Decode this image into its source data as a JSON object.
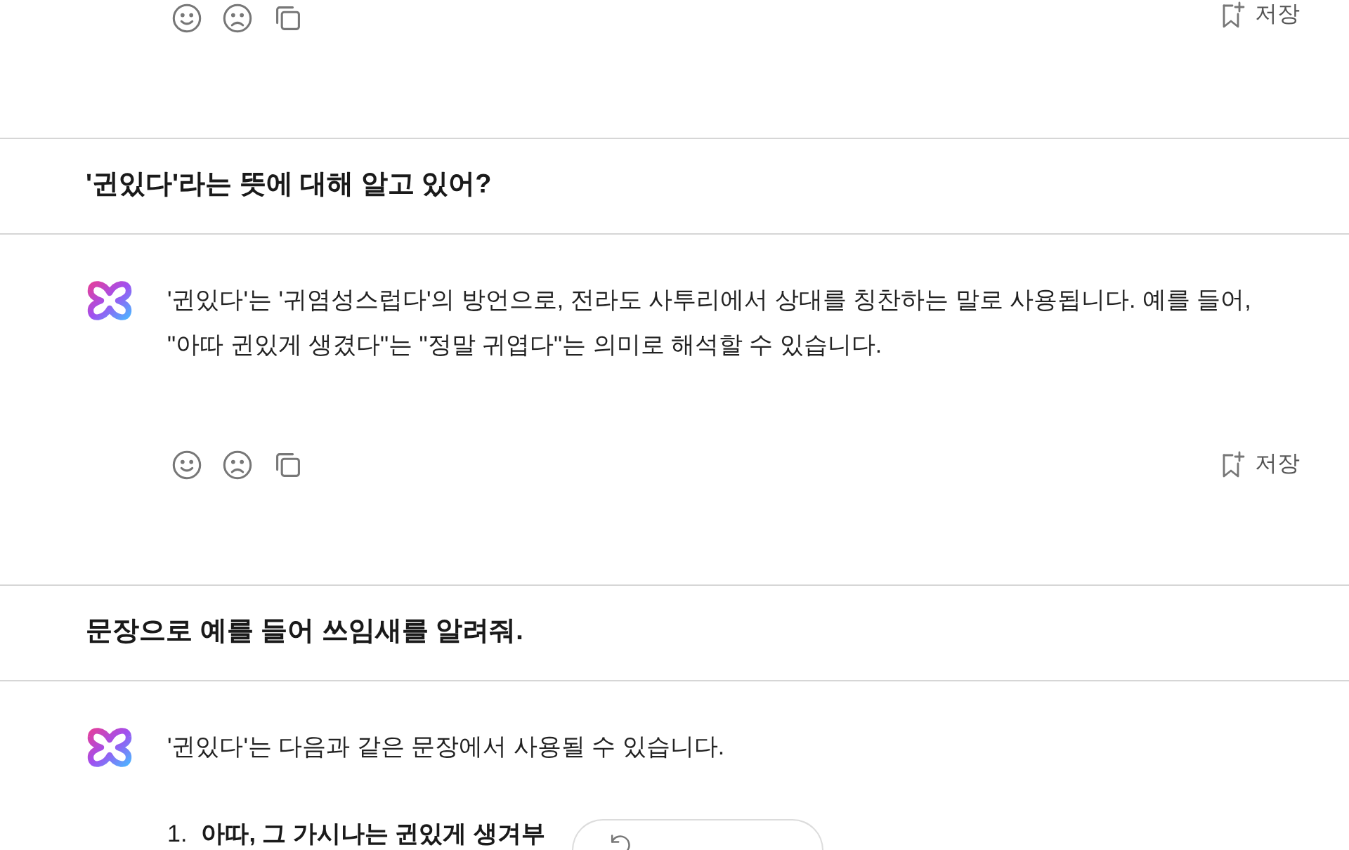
{
  "blocks": [
    {
      "kind": "actions",
      "save_label": "저장"
    },
    {
      "kind": "question",
      "text": "'귄있다'라는 뜻에 대해 알고 있어?"
    },
    {
      "kind": "answer",
      "paragraphs": [
        "'귄있다'는 '귀염성스럽다'의 방언으로, 전라도 사투리에서 상대를 칭찬하는 말로 사용됩니다. 예를 들어, \"아따 귄있게 생겼다\"는 \"정말 귀엽다\"는 의미로 해석할 수 있습니다."
      ]
    },
    {
      "kind": "actions",
      "save_label": "저장"
    },
    {
      "kind": "question",
      "text": "문장으로 예를 들어 쓰임새를 알려줘."
    },
    {
      "kind": "answer",
      "paragraphs": [
        "'귄있다'는 다음과 같은 문장에서 사용될 수 있습니다."
      ],
      "list": [
        {
          "number": "1.",
          "text": "아따, 그 가시나는 귄있게 생겨부"
        }
      ]
    }
  ]
}
